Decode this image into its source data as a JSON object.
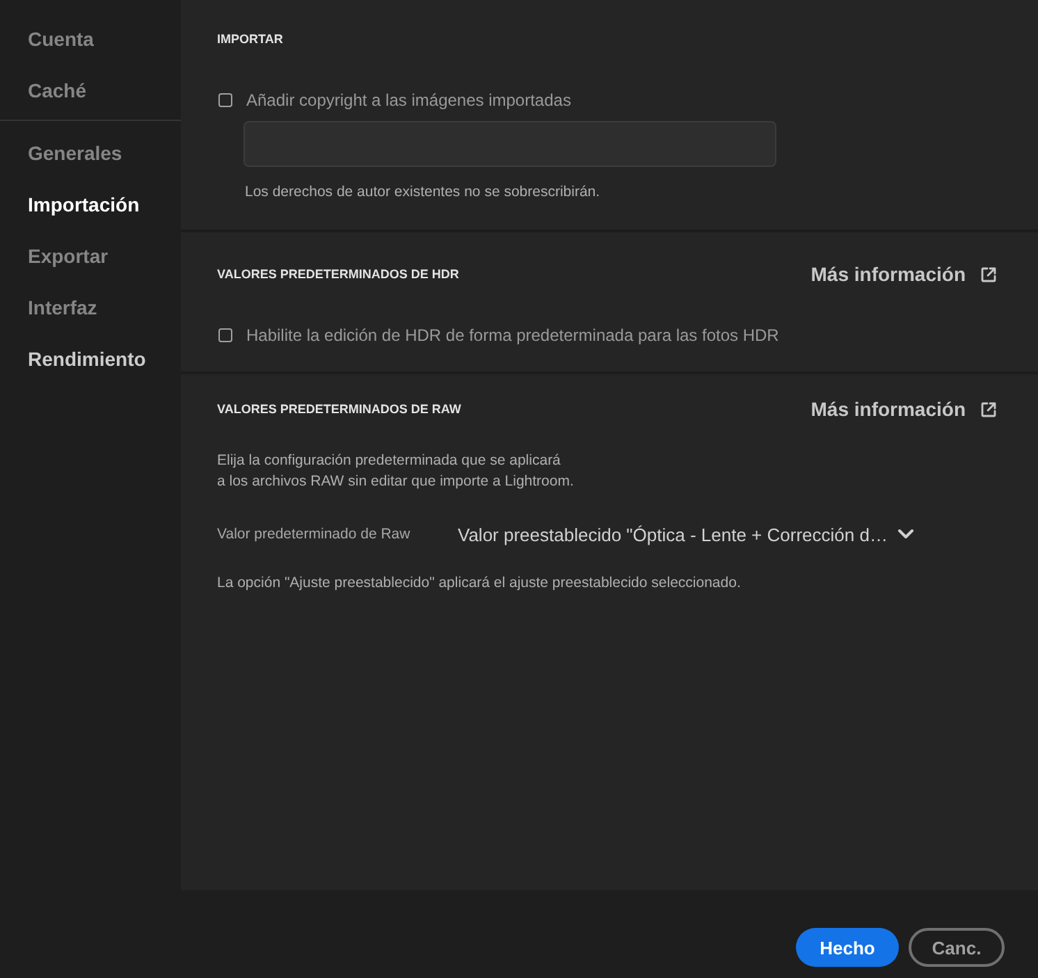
{
  "sidebar": {
    "groups": [
      {
        "items": [
          {
            "label": "Cuenta",
            "selected": false,
            "hovered": false
          },
          {
            "label": "Caché",
            "selected": false,
            "hovered": false
          }
        ]
      },
      {
        "items": [
          {
            "label": "Generales",
            "selected": false,
            "hovered": false
          },
          {
            "label": "Importación",
            "selected": true,
            "hovered": false
          },
          {
            "label": "Exportar",
            "selected": false,
            "hovered": false
          },
          {
            "label": "Interfaz",
            "selected": false,
            "hovered": false
          },
          {
            "label": "Rendimiento",
            "selected": false,
            "hovered": true
          }
        ]
      }
    ]
  },
  "sections": [
    {
      "heading": "IMPORTAR",
      "rows": [
        {
          "kind": "checkbox",
          "label": "Añadir copyright a las imágenes importadas",
          "checked": false
        },
        {
          "kind": "field"
        },
        {
          "kind": "note",
          "text": "Los derechos de autor existentes no se sobrescribirán."
        }
      ]
    },
    {
      "heading": "VALORES PREDETERMINADOS DE HDR",
      "link": "Más información",
      "rows": [
        {
          "kind": "checkbox",
          "label": "Habilite la edición de HDR de forma predeterminada para las fotos HDR",
          "checked": false
        }
      ]
    },
    {
      "heading": "VALORES PREDETERMINADOS DE RAW",
      "link": "Más información",
      "rows": [
        {
          "kind": "paragraph",
          "lines": [
            "Elija la configuración predeterminada que se aplicará",
            "a los archivos RAW sin editar que importe a Lightroom."
          ]
        },
        {
          "kind": "dropdown",
          "label": "Valor predeterminado de Raw",
          "value": "Valor preestablecido \"Óptica - Lente + Corrección d…"
        },
        {
          "kind": "note",
          "text": "La opción \"Ajuste preestablecido\" aplicará el ajuste preestablecido seleccionado."
        }
      ]
    }
  ],
  "footer": {
    "buttons": [
      {
        "label": "Hecho",
        "kind": "primary"
      },
      {
        "label": "Canc.",
        "kind": "secondary"
      }
    ]
  }
}
